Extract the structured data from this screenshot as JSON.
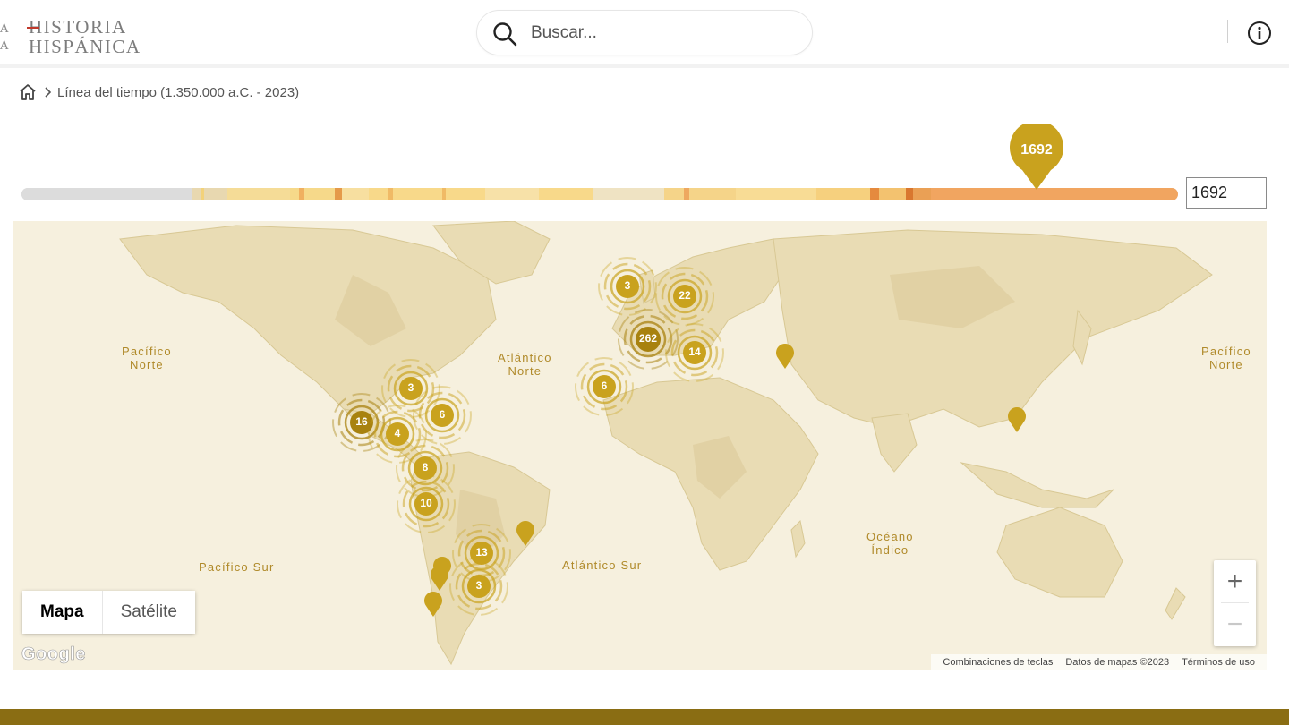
{
  "header": {
    "logo_edge": [
      "A",
      "A"
    ],
    "logo_lines": [
      "HISTORIA",
      "HISPÁNICA"
    ],
    "search_placeholder": "Buscar...",
    "search_icon": "search-icon",
    "info_icon": "info-icon"
  },
  "breadcrumb": {
    "home_icon": "home-icon",
    "separator_icon": "chevron-right-icon",
    "current": "Línea del tiempo (1.350.000 a.C. - 2023)"
  },
  "timeline": {
    "selected_year": "1692",
    "input_value": "1692"
  },
  "map": {
    "ocean_labels": [
      "Pacífico\nNorte",
      "Atlántico\nNorte",
      "Pacífico\nNorte",
      "Pacífico Sur",
      "Atlántico Sur",
      "Océano\nÍndico"
    ],
    "clusters": [
      "3",
      "22",
      "262",
      "14",
      "6",
      "3",
      "16",
      "6",
      "4",
      "8",
      "10",
      "13",
      "3"
    ],
    "map_types": [
      "Mapa",
      "Satélite"
    ],
    "active_map_type": "Mapa",
    "zoom_in": "+",
    "zoom_out": "−",
    "google_logo": "Google",
    "footer": [
      "Combinaciones de teclas",
      "Datos de mapas ©2023",
      "Términos de uso"
    ]
  },
  "colors": {
    "accent": "#c9a21e",
    "accent_dark": "#a8820f",
    "map_bg": "#f6f0de",
    "footer_bar": "#8a6d13",
    "timeline_active": "#f1a560"
  }
}
